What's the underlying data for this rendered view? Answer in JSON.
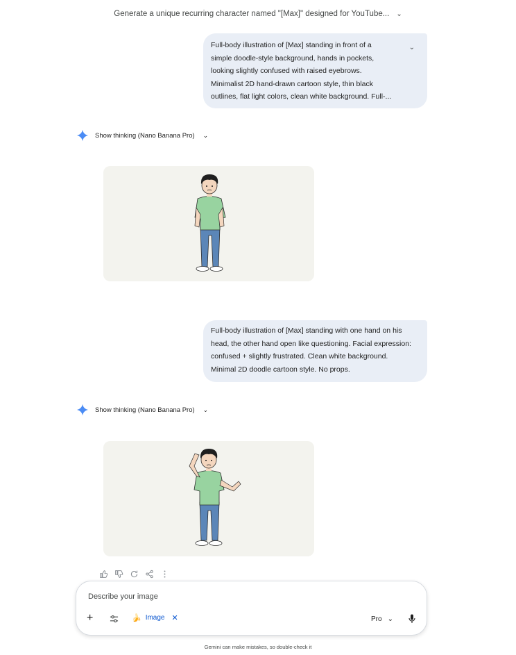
{
  "conversation": {
    "title": "Generate a unique recurring character named \"[Max]\" designed for YouTube...",
    "title_chevron_icon": "chevron-down-icon"
  },
  "messages": [
    {
      "role": "user",
      "lines": [
        "Full-body illustration of [Max] standing in front of a",
        "simple doodle-style background, hands in pockets,",
        "looking slightly confused with raised eyebrows.",
        "Minimalist 2D hand-drawn cartoon style, thin black",
        "outlines, flat light colors, clean white background. Full-..."
      ]
    },
    {
      "role": "model",
      "thinking_label": "Show thinking (Nano Banana Pro)",
      "image_description_icon": "generated-image"
    },
    {
      "role": "user",
      "lines": [
        "Full-body illustration of [Max] standing with one hand on his",
        "head, the other hand open like questioning. Facial expression:",
        "confused + slightly frustrated. Clean white background.",
        "Minimal 2D doodle cartoon style. No props."
      ]
    },
    {
      "role": "model",
      "thinking_label": "Show thinking (Nano Banana Pro)",
      "image_description_icon": "generated-image"
    }
  ],
  "response_actions": [
    "thumbs-up-icon",
    "thumbs-down-icon",
    "regenerate-icon",
    "share-icon",
    "more-icon"
  ],
  "composer": {
    "placeholder": "Describe your image",
    "chip_label": "Image",
    "model_label": "Pro"
  },
  "footer": {
    "disclaimer": "Gemini can make mistakes, so double-check it"
  },
  "colors": {
    "bubble": "#e9eef6",
    "accent": "#0b57d0",
    "image_bg": "#f3f3ee",
    "shirt": "#98d3a0",
    "jeans": "#5b86b8"
  }
}
